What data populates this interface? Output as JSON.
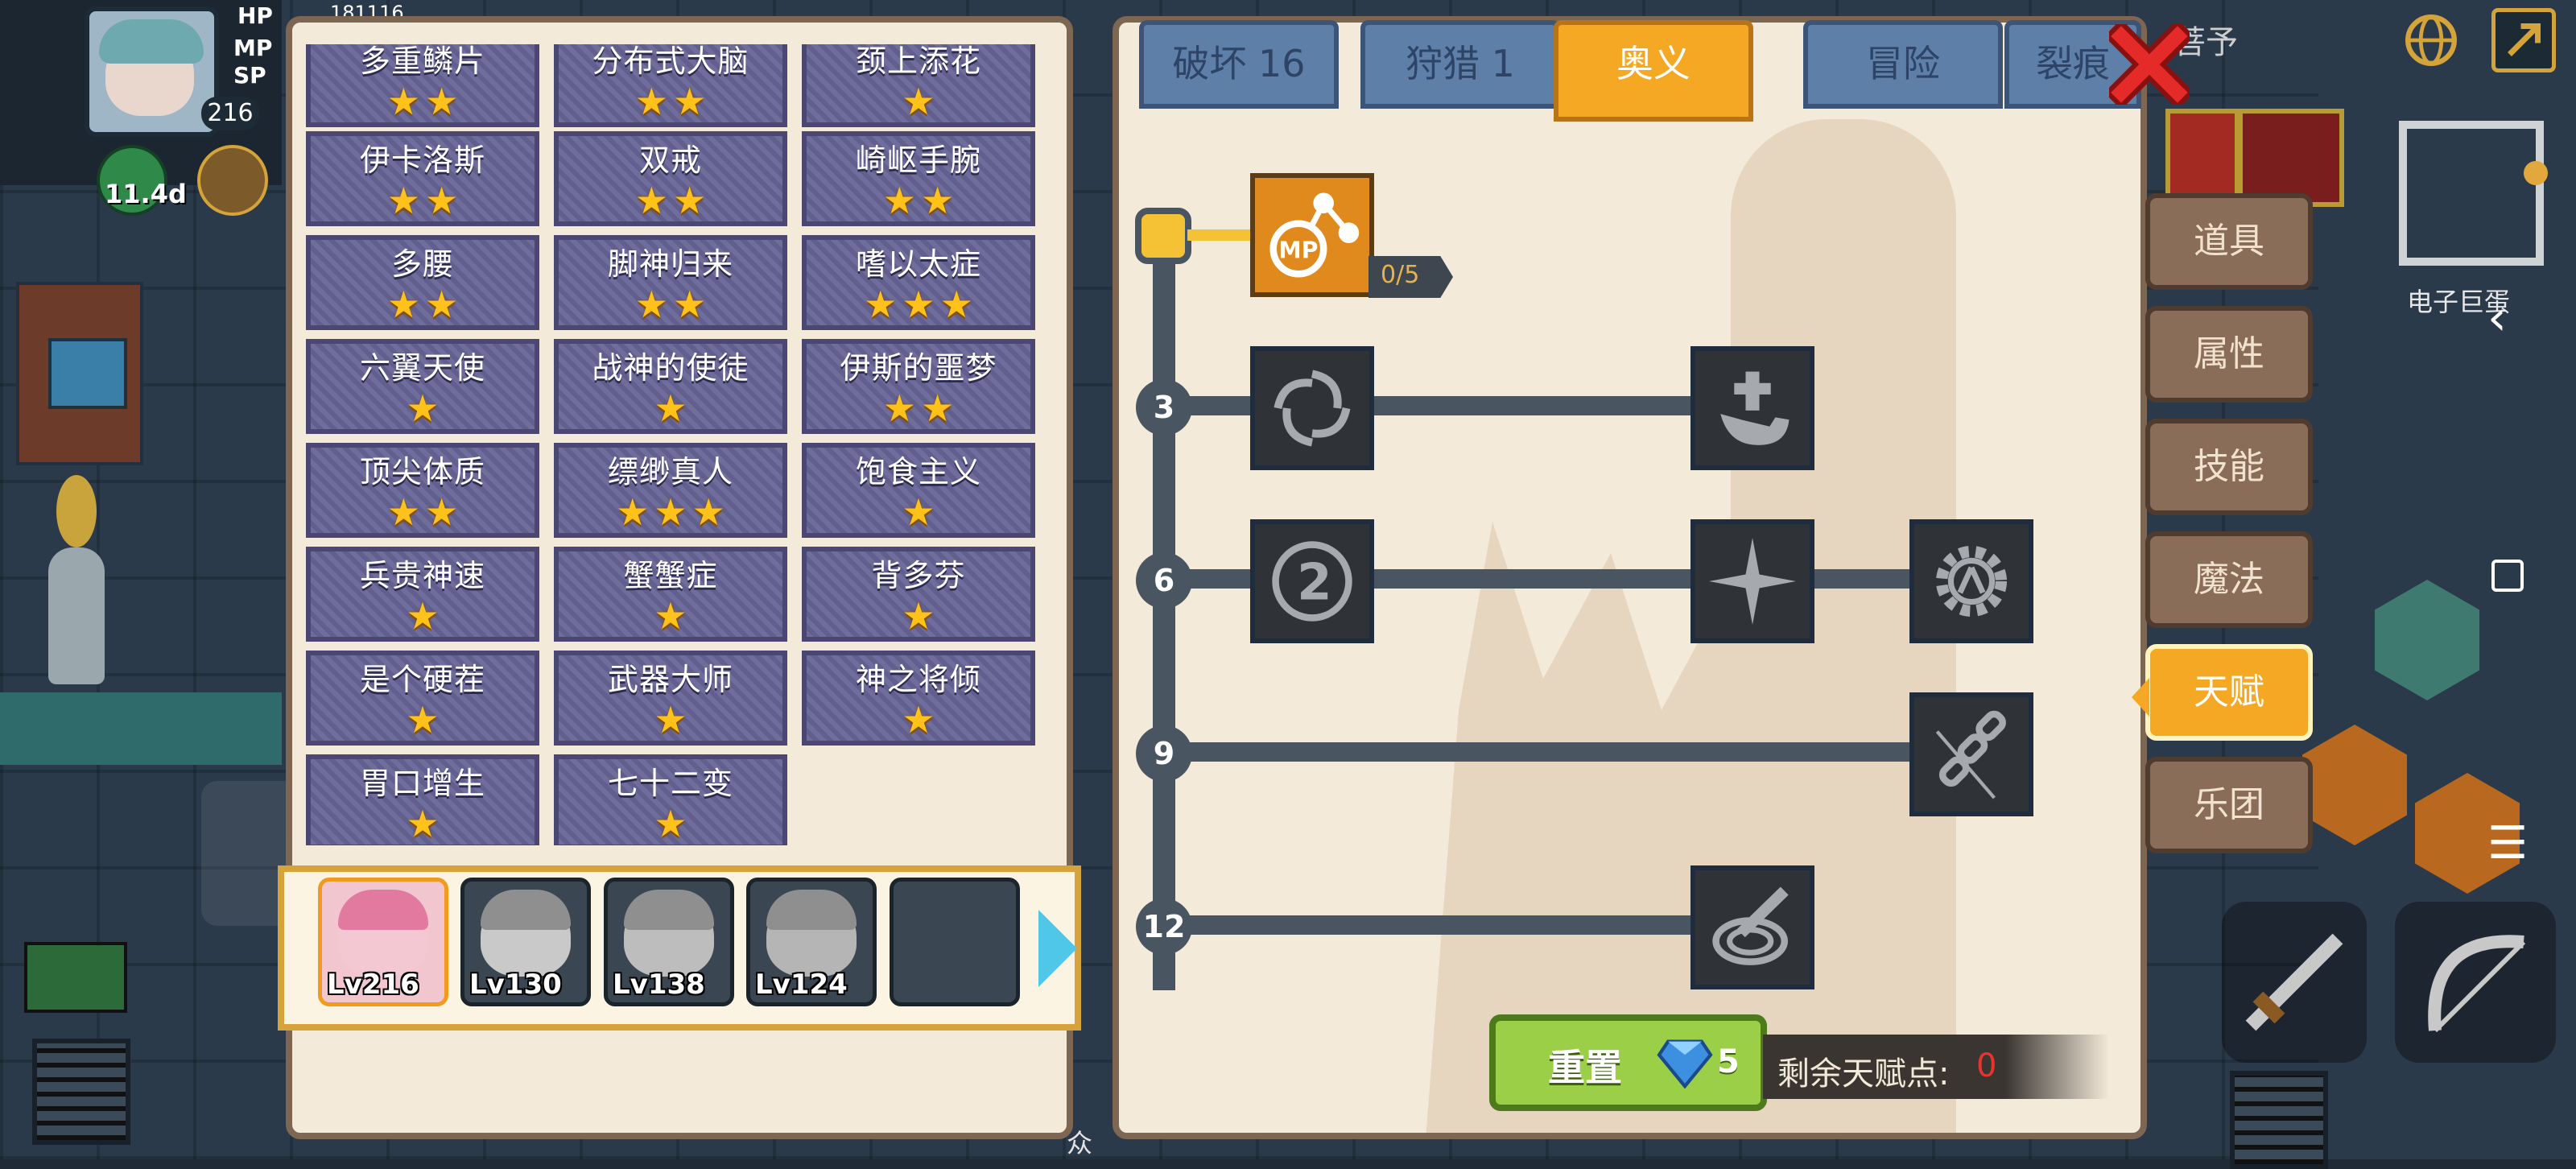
{
  "hud": {
    "hp_label": "HP",
    "mp_label": "MP",
    "sp_label": "SP",
    "hp_value": "181116",
    "level_badge": "216",
    "timer": "11.4d",
    "map_label": "电子巨蛋",
    "top_right_text": "菩予"
  },
  "traits": [
    {
      "name": "多重鳞片",
      "stars": 2
    },
    {
      "name": "分布式大脑",
      "stars": 2
    },
    {
      "name": "颈上添花",
      "stars": 1
    },
    {
      "name": "伊卡洛斯",
      "stars": 2
    },
    {
      "name": "双戒",
      "stars": 2
    },
    {
      "name": "崎岖手腕",
      "stars": 2
    },
    {
      "name": "多腰",
      "stars": 2
    },
    {
      "name": "脚神归来",
      "stars": 2
    },
    {
      "name": "嗜以太症",
      "stars": 3
    },
    {
      "name": "六翼天使",
      "stars": 1
    },
    {
      "name": "战神的使徒",
      "stars": 1
    },
    {
      "name": "伊斯的噩梦",
      "stars": 2
    },
    {
      "name": "顶尖体质",
      "stars": 2
    },
    {
      "name": "缥缈真人",
      "stars": 3
    },
    {
      "name": "饱食主义",
      "stars": 1
    },
    {
      "name": "兵贵神速",
      "stars": 1
    },
    {
      "name": "蟹蟹症",
      "stars": 1
    },
    {
      "name": "背多芬",
      "stars": 1
    },
    {
      "name": "是个硬茬",
      "stars": 1
    },
    {
      "name": "武器大师",
      "stars": 1
    },
    {
      "name": "神之将倾",
      "stars": 1
    },
    {
      "name": "胃口增生",
      "stars": 1
    },
    {
      "name": "七十二变",
      "stars": 1
    }
  ],
  "team": [
    {
      "level": "Lv216",
      "active": true
    },
    {
      "level": "Lv130",
      "active": false
    },
    {
      "level": "Lv138",
      "active": false
    },
    {
      "level": "Lv124",
      "active": false
    },
    {
      "level": "",
      "active": false
    }
  ],
  "tabs": [
    {
      "label": "破坏 16",
      "active": false
    },
    {
      "label": "狩猎 1",
      "active": false
    },
    {
      "label": "奥义",
      "active": true
    },
    {
      "label": "冒险",
      "active": false
    },
    {
      "label": "裂痕",
      "active": false
    }
  ],
  "tree": {
    "first_skill_progress": "0/5",
    "tiers": [
      "3",
      "6",
      "9",
      "12"
    ]
  },
  "reset": {
    "label": "重置",
    "cost": "5"
  },
  "points": {
    "label": "剩余天赋点:",
    "value": "0"
  },
  "side_menu": [
    {
      "label": "道具",
      "active": false
    },
    {
      "label": "属性",
      "active": false
    },
    {
      "label": "技能",
      "active": false
    },
    {
      "label": "魔法",
      "active": false
    },
    {
      "label": "天赋",
      "active": true
    },
    {
      "label": "乐团",
      "active": false
    }
  ],
  "colors": {
    "accent": "#f5a823",
    "star": "#ffc21a",
    "points_value": "#e8342f",
    "reset_button": "#9bcf47"
  }
}
